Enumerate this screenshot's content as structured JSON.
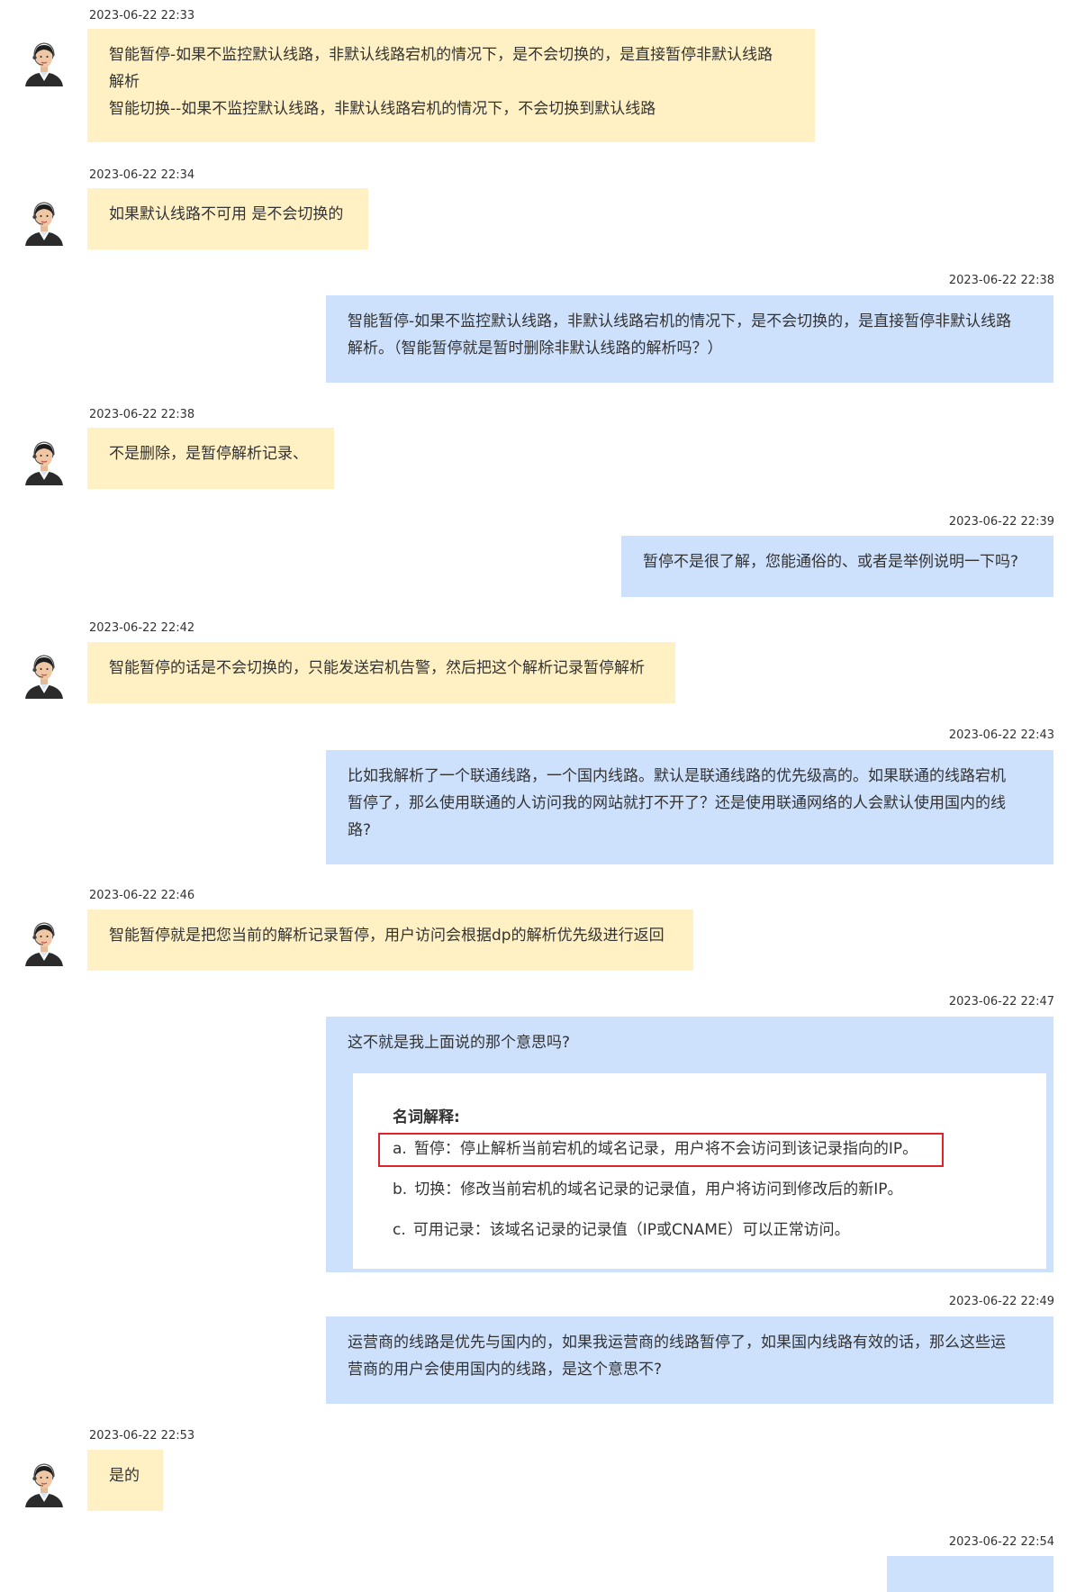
{
  "messages": [
    {
      "side": "agent",
      "time": "2023-06-22 22:33",
      "text": "智能暂停-如果不监控默认线路，非默认线路宕机的情况下，是不会切换的，是直接暂停非默认线路\n解析\n智能切换--如果不监控默认线路，非默认线路宕机的情况下，不会切换到默认线路"
    },
    {
      "side": "agent",
      "time": "2023-06-22 22:34",
      "text": "如果默认线路不可用 是不会切换的"
    },
    {
      "side": "user",
      "time": "2023-06-22 22:38",
      "text": "智能暂停-如果不监控默认线路，非默认线路宕机的情况下，是不会切换的，是直接暂停非默认线路\n解析。（智能暂停就是暂时删除非默认线路的解析吗？）"
    },
    {
      "side": "agent",
      "time": "2023-06-22 22:38",
      "text": "不是删除，是暂停解析记录、"
    },
    {
      "side": "user",
      "time": "2023-06-22 22:39",
      "text": "暂停不是很了解，您能通俗的、或者是举例说明一下吗?"
    },
    {
      "side": "agent",
      "time": "2023-06-22 22:42",
      "text": "智能暂停的话是不会切换的，只能发送宕机告警，然后把这个解析记录暂停解析"
    },
    {
      "side": "user",
      "time": "2023-06-22 22:43",
      "text": "比如我解析了一个联通线路，一个国内线路。默认是联通线路的优先级高的。如果联通的线路宕机\n暂停了，那么使用联通的人访问我的网站就打不开了？还是使用联通网络的人会默认使用国内的线\n路?"
    },
    {
      "side": "agent",
      "time": "2023-06-22 22:46",
      "text": "智能暂停就是把您当前的解析记录暂停，用户访问会根据dp的解析优先级进行返回"
    },
    {
      "side": "user",
      "time": "2023-06-22 22:47",
      "text": "这不就是我上面说的那个意思吗?"
    },
    {
      "side": "user",
      "time": "2023-06-22 22:49",
      "text": "运营商的线路是优先与国内的，如果我运营商的线路暂停了，如果国内线路有效的话，那么这些运\n营商的用户会使用国内的线路，是这个意思不?"
    },
    {
      "side": "agent",
      "time": "2023-06-22 22:53",
      "text": "是的"
    },
    {
      "side": "user",
      "time": "2023-06-22 22:54",
      "text": ""
    }
  ],
  "screenshot": {
    "title": "名词解释:",
    "items": [
      {
        "letter": "a.",
        "text": "暂停：停止解析当前宕机的域名记录，用户将不会访问到该记录指向的IP。",
        "highlighted": true
      },
      {
        "letter": "b.",
        "text": "切换：修改当前宕机的域名记录的记录值，用户将访问到修改后的新IP。",
        "highlighted": false
      },
      {
        "letter": "c.",
        "text": "可用记录：该域名记录的记录值（IP或CNAME）可以正常访问。",
        "highlighted": false
      }
    ]
  },
  "colors": {
    "agent_bubble": "#fff1c4",
    "user_bubble": "#cde0fc",
    "highlight_border": "#e0232b"
  }
}
